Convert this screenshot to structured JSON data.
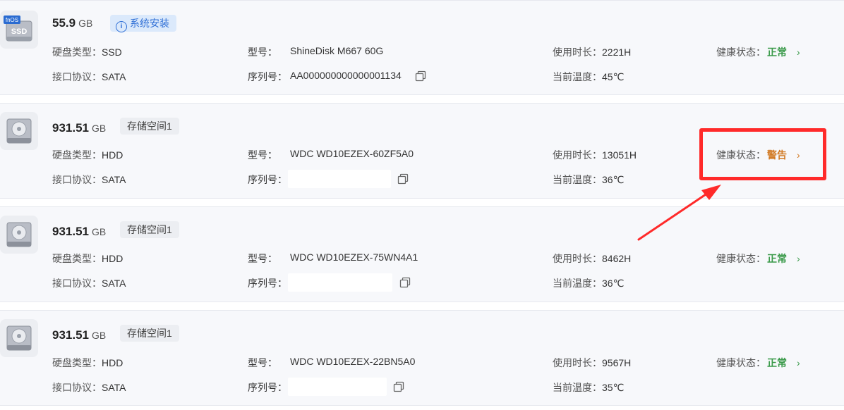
{
  "labels": {
    "disk_type": "硬盘类型：",
    "interface": "接口协议：",
    "model": "型号：",
    "serial": "序列号：",
    "usage": "使用时长：",
    "temp": "当前温度：",
    "health": "健康状态："
  },
  "colors": {
    "ok": "#3a9a4a",
    "warn": "#d27a24",
    "highlight": "#ff2a2a",
    "tag_blue": "#2f6fd6"
  },
  "disks": [
    {
      "capacity": "55.9",
      "unit": "GB",
      "tag": "系统安装",
      "badge": "fnOS",
      "icon": "ssd-drive-icon",
      "type": "SSD",
      "interface": "SATA",
      "model": "ShineDisk M667 60G",
      "serial": "AA000000000000001134",
      "usage": "2221H",
      "temp": "45℃",
      "health": "正常"
    },
    {
      "capacity": "931.51",
      "unit": "GB",
      "tag": "存储空间1",
      "icon": "hdd-drive-icon",
      "type": "HDD",
      "interface": "SATA",
      "model": "WDC WD10EZEX-60ZF5A0",
      "serial": "",
      "usage": "13051H",
      "temp": "36℃",
      "health": "警告"
    },
    {
      "capacity": "931.51",
      "unit": "GB",
      "tag": "存储空间1",
      "icon": "hdd-drive-icon",
      "type": "HDD",
      "interface": "SATA",
      "model": "WDC WD10EZEX-75WN4A1",
      "serial": "",
      "usage": "8462H",
      "temp": "36℃",
      "health": "正常"
    },
    {
      "capacity": "931.51",
      "unit": "GB",
      "tag": "存储空间1",
      "icon": "hdd-drive-icon",
      "type": "HDD",
      "interface": "SATA",
      "model": "WDC WD10EZEX-22BN5A0",
      "serial": "",
      "usage": "9567H",
      "temp": "35℃",
      "health": "正常"
    }
  ]
}
